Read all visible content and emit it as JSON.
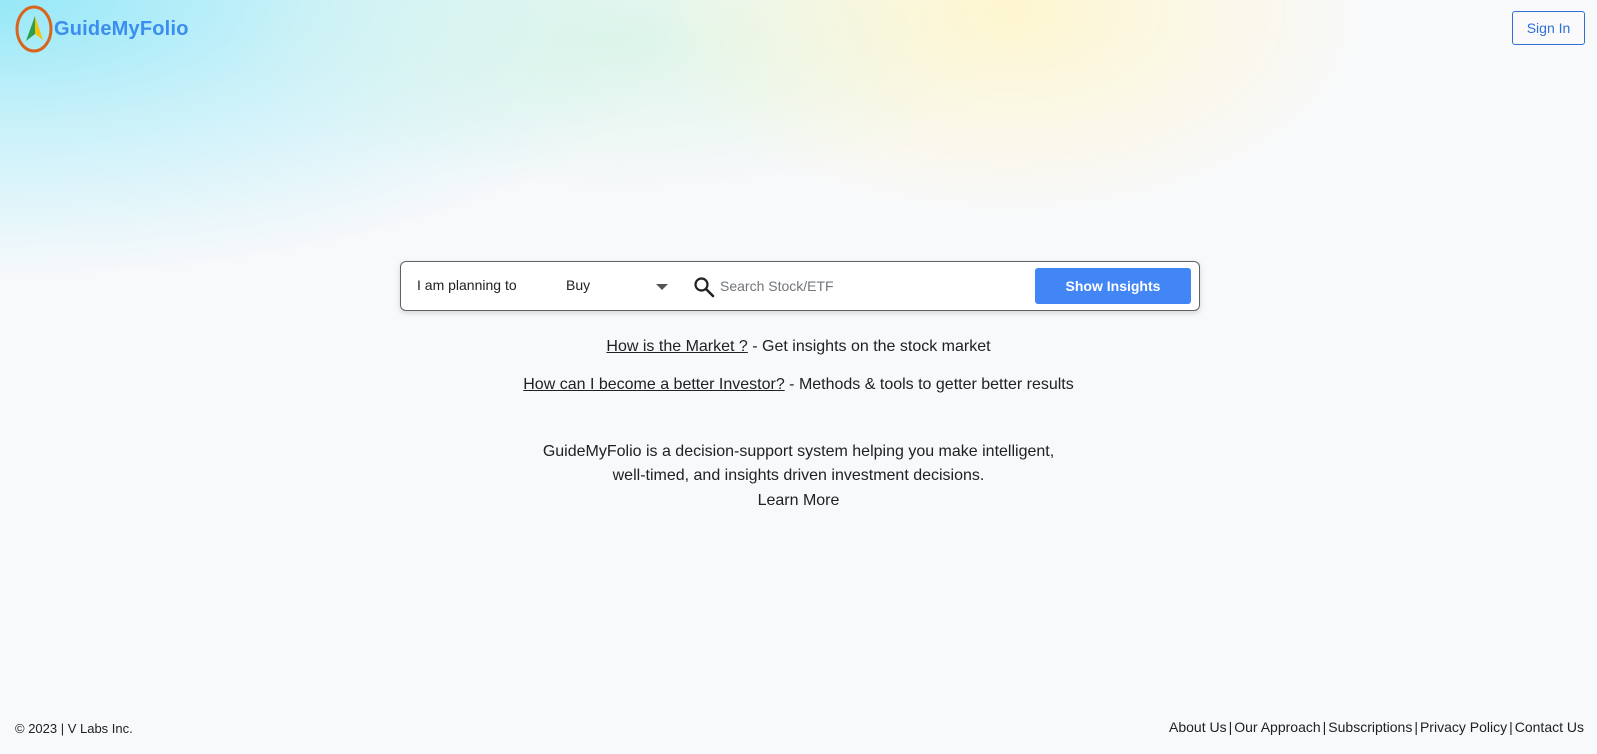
{
  "brand": {
    "name": "GuideMyFolio",
    "logo_ring_color": "#d9641e",
    "logo_arrow_colors": [
      "#2e9e4f",
      "#f4c20d"
    ],
    "text_color": "#3b8ef0"
  },
  "header": {
    "signin_label": "Sign In"
  },
  "search": {
    "planning_label": "I am planning to",
    "action_value": "Buy",
    "placeholder": "Search Stock/ETF",
    "submit_label": "Show Insights",
    "icon": "search-icon",
    "button_color": "#4285f4"
  },
  "quick_links": [
    {
      "link": "How is the Market ?",
      "suffix": " - Get insights on the stock market"
    },
    {
      "link": "How can I become a better Investor?",
      "suffix": " - Methods & tools to getter better results"
    }
  ],
  "description": {
    "line1": "GuideMyFolio is a decision-support system helping you make intelligent,",
    "line2": "well-timed, and insights driven investment decisions.",
    "learn_more": "Learn More"
  },
  "footer": {
    "copyright": "© 2023 | V Labs Inc.",
    "separator": "|",
    "links": [
      "About Us",
      "Our Approach",
      "Subscriptions",
      "Privacy Policy",
      "Contact Us"
    ]
  }
}
